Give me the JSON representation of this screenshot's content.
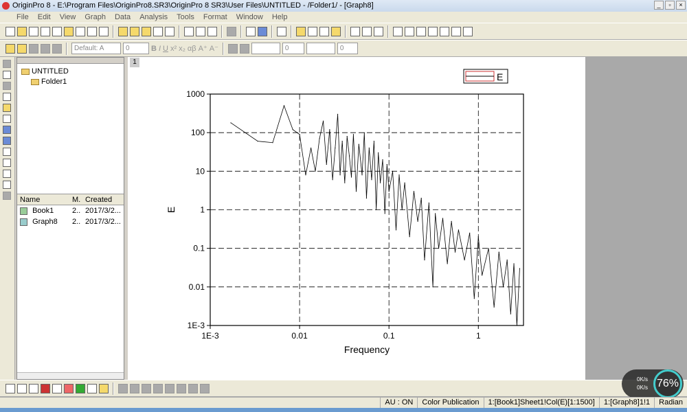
{
  "window": {
    "title": "OriginPro 8 - E:\\Program Files\\OriginPro8.SR3\\OriginPro 8 SR3\\User Files\\UNTITLED - /Folder1/ - [Graph8]"
  },
  "menu": [
    "File",
    "Edit",
    "View",
    "Graph",
    "Data",
    "Analysis",
    "Tools",
    "Format",
    "Window",
    "Help"
  ],
  "format_toolbar": {
    "font": "Default: A",
    "size": "0",
    "line_width": "0",
    "fill": "0"
  },
  "explorer": {
    "root": "UNTITLED",
    "folder": "Folder1",
    "columns": [
      "Name",
      "M.",
      "Created"
    ],
    "items": [
      {
        "name": "Book1",
        "m": "2..",
        "created": "2017/3/2..."
      },
      {
        "name": "Graph8",
        "m": "2..",
        "created": "2017/3/2..."
      }
    ]
  },
  "graph": {
    "page": "1"
  },
  "status": {
    "au": "AU : ON",
    "theme": "Color Publication",
    "dataset": "1:[Book1]Sheet1!Col(E)[1:1500]",
    "layer": "1:[Graph8]1!1",
    "angle": "Radian"
  },
  "overlay": {
    "speed_up": "0K/s",
    "speed_down": "0K/s",
    "percent": "76%"
  },
  "chart_data": {
    "type": "line",
    "xlabel": "Frequency",
    "ylabel": "E",
    "xscale": "log",
    "yscale": "log",
    "xlim": [
      0.001,
      3.2
    ],
    "ylim": [
      0.001,
      1000
    ],
    "xticks": [
      "1E-3",
      "0.01",
      "0.1",
      "1"
    ],
    "yticks": [
      "1E-3",
      "0.01",
      "0.1",
      "1",
      "10",
      "100",
      "1000"
    ],
    "grid": "dashed at major ticks",
    "legend": {
      "position": "top-right",
      "entries": [
        "E"
      ]
    },
    "series": [
      {
        "name": "E",
        "color": "#000000",
        "x": [
          0.0017,
          0.0034,
          0.005,
          0.0067,
          0.0084,
          0.01,
          0.0117,
          0.0134,
          0.015,
          0.0167,
          0.0184,
          0.02,
          0.0217,
          0.0234,
          0.025,
          0.0267,
          0.0284,
          0.03,
          0.032,
          0.034,
          0.036,
          0.038,
          0.04,
          0.043,
          0.046,
          0.05,
          0.053,
          0.056,
          0.06,
          0.064,
          0.068,
          0.072,
          0.076,
          0.08,
          0.085,
          0.09,
          0.095,
          0.1,
          0.11,
          0.12,
          0.13,
          0.14,
          0.15,
          0.17,
          0.19,
          0.21,
          0.23,
          0.25,
          0.28,
          0.31,
          0.33,
          0.36,
          0.4,
          0.45,
          0.5,
          0.55,
          0.6,
          0.7,
          0.8,
          0.9,
          1.0,
          1.1,
          1.3,
          1.5,
          1.7,
          1.9,
          2.1,
          2.3,
          2.5,
          2.7,
          2.9
        ],
        "y": [
          180,
          60,
          55,
          500,
          120,
          90,
          8,
          40,
          10,
          70,
          200,
          15,
          120,
          6,
          40,
          300,
          8,
          60,
          5,
          80,
          25,
          7,
          90,
          3,
          50,
          8,
          100,
          2,
          40,
          6,
          60,
          1,
          30,
          5,
          20,
          0.8,
          15,
          3,
          10,
          0.3,
          8,
          1,
          5,
          0.2,
          3,
          0.5,
          2,
          0.05,
          1.5,
          0.01,
          0.8,
          0.1,
          0.6,
          0.04,
          0.5,
          0.08,
          0.3,
          0.05,
          0.25,
          0.005,
          0.2,
          0.02,
          0.1,
          0.003,
          0.08,
          0.01,
          0.05,
          0.002,
          0.04,
          0.001,
          0.03
        ]
      }
    ]
  }
}
